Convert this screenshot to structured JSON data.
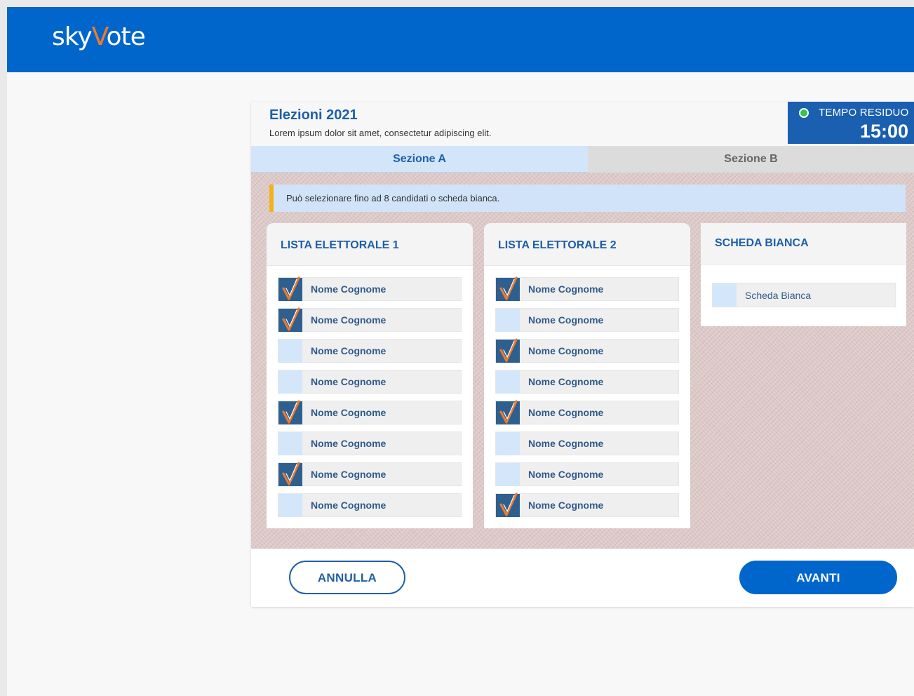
{
  "brand": {
    "logo_pre": "sky",
    "logo_accent": "V",
    "logo_post": "ote"
  },
  "election": {
    "title": "Elezioni 2021",
    "subtitle": "Lorem ipsum dolor sit amet, consectetur adipiscing elit."
  },
  "timer": {
    "label": "TEMPO RESIDUO",
    "value": "15:00"
  },
  "tabs": [
    {
      "label": "Sezione A",
      "active": true
    },
    {
      "label": "Sezione B",
      "active": false
    }
  ],
  "notice": "Può selezionare fino ad 8 candidati o scheda bianca.",
  "lists": [
    {
      "title": "LISTA ELETTORALE 1",
      "candidates": [
        {
          "name": "Nome Cognome",
          "checked": true
        },
        {
          "name": "Nome Cognome",
          "checked": true
        },
        {
          "name": "Nome Cognome",
          "checked": false
        },
        {
          "name": "Nome Cognome",
          "checked": false
        },
        {
          "name": "Nome Cognome",
          "checked": true
        },
        {
          "name": "Nome Cognome",
          "checked": false
        },
        {
          "name": "Nome Cognome",
          "checked": true
        },
        {
          "name": "Nome Cognome",
          "checked": false
        }
      ]
    },
    {
      "title": "LISTA ELETTORALE 2",
      "candidates": [
        {
          "name": "Nome Cognome",
          "checked": true
        },
        {
          "name": "Nome Cognome",
          "checked": false
        },
        {
          "name": "Nome Cognome",
          "checked": true
        },
        {
          "name": "Nome Cognome",
          "checked": false
        },
        {
          "name": "Nome Cognome",
          "checked": true
        },
        {
          "name": "Nome Cognome",
          "checked": false
        },
        {
          "name": "Nome Cognome",
          "checked": false
        },
        {
          "name": "Nome Cognome",
          "checked": true
        }
      ]
    }
  ],
  "blank_ballot": {
    "title": "SCHEDA BIANCA",
    "option_label": "Scheda Bianca",
    "checked": false
  },
  "buttons": {
    "cancel": "ANNULLA",
    "next": "AVANTI"
  },
  "colors": {
    "header_blue": "#0066cc",
    "brand_orange": "#ee7a2a",
    "check_orange": "#ee7a2a",
    "checked_box": "#2f5f8f",
    "unchecked_box": "#d4e6f9",
    "notice_accent": "#f3b21b",
    "timer_dot": "#2ec84a"
  }
}
